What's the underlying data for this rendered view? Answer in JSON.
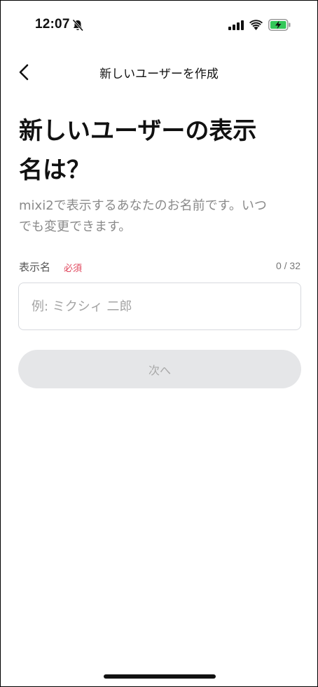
{
  "status_bar": {
    "time": "12:07",
    "icons": [
      "bell-slash-icon",
      "signal-icon",
      "wifi-icon",
      "battery-charging-icon"
    ],
    "battery_color": "#34c759"
  },
  "header": {
    "title": "新しいユーザーを作成",
    "back_icon": "chevron-left-icon"
  },
  "main": {
    "heading_line1": "新しいユーザーの表示",
    "heading_line2": "名は？",
    "description_line1": "mixi2で表示するあなたのお名前です。いつ",
    "description_line2": "でも変更できます。",
    "field": {
      "label": "表示名",
      "required_label": "必須",
      "required_color": "#e0455c",
      "counter": "0 / 32",
      "value": "",
      "placeholder": "例: ミクシィ 二郎"
    },
    "next_button_label": "次へ"
  }
}
